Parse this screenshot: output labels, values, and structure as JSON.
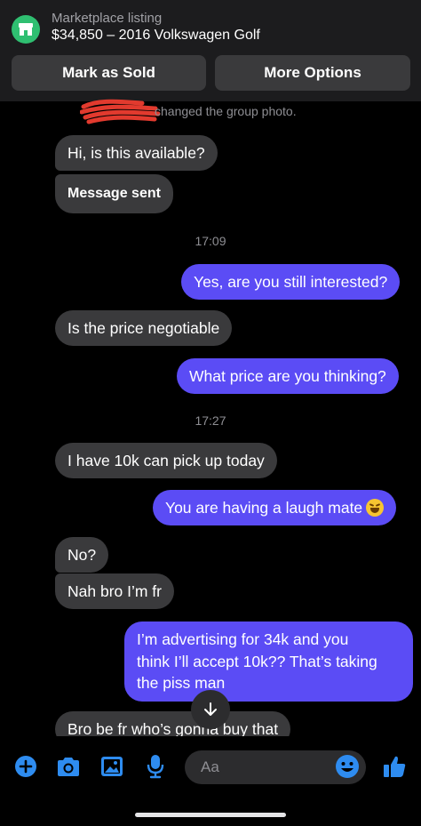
{
  "header": {
    "listing_label": "Marketplace listing",
    "listing_title": "$34,850 – 2016 Volkswagen Golf",
    "mark_sold_label": "Mark as Sold",
    "more_options_label": "More Options"
  },
  "system_message": "changed the group photo.",
  "messages": [
    {
      "text": "Hi, is this available?"
    },
    {
      "text": "Message sent"
    },
    {
      "timestamp": "17:09"
    },
    {
      "text": "Yes, are you still interested?"
    },
    {
      "text": "Is the price negotiable"
    },
    {
      "text": "What price are you thinking?"
    },
    {
      "timestamp": "17:27"
    },
    {
      "text": "I have 10k can pick up today"
    },
    {
      "text": "You are having a laugh mate"
    },
    {
      "text": "No?"
    },
    {
      "text": "Nah bro I’m fr"
    },
    {
      "lines": [
        "I’m advertising for 34k and you",
        "think I’ll accept 10k?? That’s taking",
        "the piss man"
      ]
    },
    {
      "text": "Bro be fr who’s gonna buy that"
    }
  ],
  "composer": {
    "placeholder": "Aa",
    "icons": [
      "plus-icon",
      "camera-icon",
      "image-icon",
      "microphone-icon",
      "emoji-icon",
      "thumbs-up-icon"
    ]
  },
  "colors": {
    "outgoing_bubble": "#5b4cf5",
    "incoming_bubble": "#3a3a3c",
    "accent": "#2e8cf0",
    "marketplace_green": "#2fbf71"
  }
}
